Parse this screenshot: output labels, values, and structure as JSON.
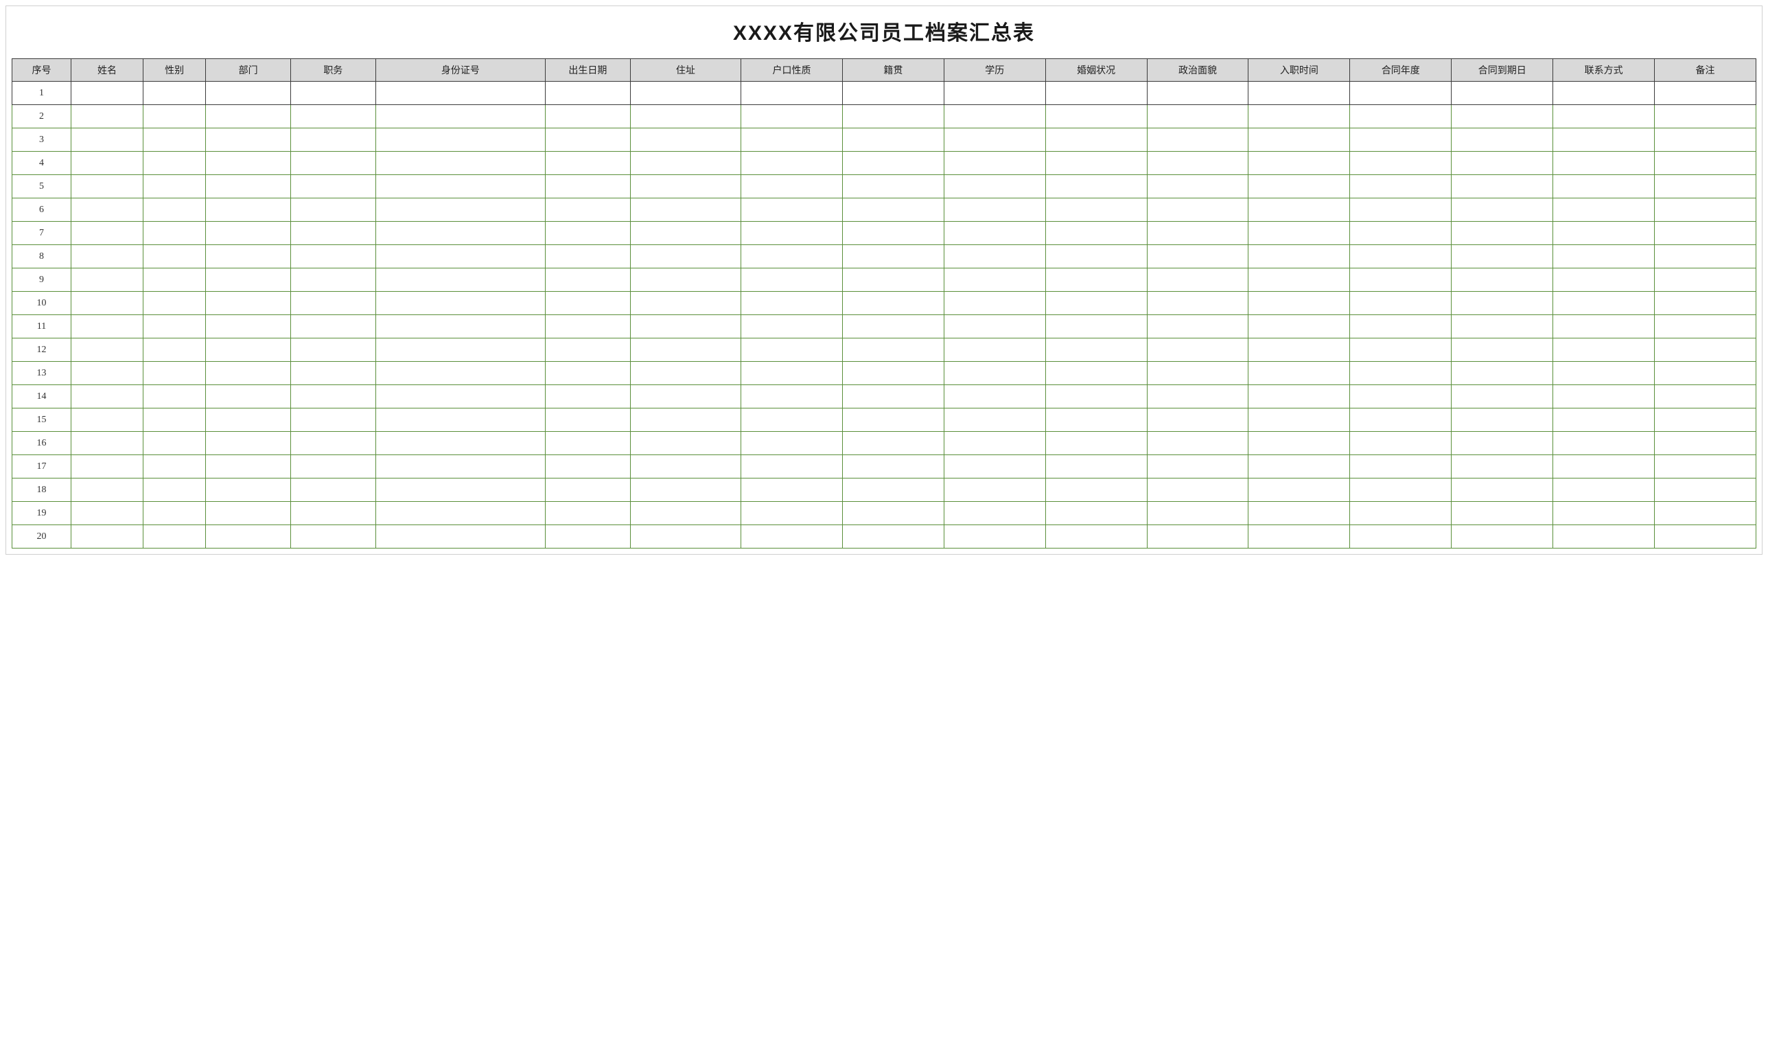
{
  "title": "XXXX有限公司员工档案汇总表",
  "headers": [
    "序号",
    "姓名",
    "性别",
    "部门",
    "职务",
    "身份证号",
    "出生日期",
    "住址",
    "户口性质",
    "籍贯",
    "学历",
    "婚姻状况",
    "政治面貌",
    "入职时间",
    "合同年度",
    "合同到期日",
    "联系方式",
    "备注"
  ],
  "col_classes": [
    "col-seq",
    "col-name",
    "col-gender",
    "col-dept",
    "col-pos",
    "col-id",
    "col-birth",
    "col-addr",
    "col-huko",
    "col-origin",
    "col-edu",
    "col-marital",
    "col-polit",
    "col-hire",
    "col-cyear",
    "col-cexp",
    "col-contact",
    "col-remark"
  ],
  "rows": [
    {
      "seq": "1",
      "cells": [
        "",
        "",
        "",
        "",
        "",
        "",
        "",
        "",
        "",
        "",
        "",
        "",
        "",
        "",
        "",
        "",
        ""
      ]
    },
    {
      "seq": "2",
      "cells": [
        "",
        "",
        "",
        "",
        "",
        "",
        "",
        "",
        "",
        "",
        "",
        "",
        "",
        "",
        "",
        "",
        ""
      ]
    },
    {
      "seq": "3",
      "cells": [
        "",
        "",
        "",
        "",
        "",
        "",
        "",
        "",
        "",
        "",
        "",
        "",
        "",
        "",
        "",
        "",
        ""
      ]
    },
    {
      "seq": "4",
      "cells": [
        "",
        "",
        "",
        "",
        "",
        "",
        "",
        "",
        "",
        "",
        "",
        "",
        "",
        "",
        "",
        "",
        ""
      ]
    },
    {
      "seq": "5",
      "cells": [
        "",
        "",
        "",
        "",
        "",
        "",
        "",
        "",
        "",
        "",
        "",
        "",
        "",
        "",
        "",
        "",
        ""
      ]
    },
    {
      "seq": "6",
      "cells": [
        "",
        "",
        "",
        "",
        "",
        "",
        "",
        "",
        "",
        "",
        "",
        "",
        "",
        "",
        "",
        "",
        ""
      ]
    },
    {
      "seq": "7",
      "cells": [
        "",
        "",
        "",
        "",
        "",
        "",
        "",
        "",
        "",
        "",
        "",
        "",
        "",
        "",
        "",
        "",
        ""
      ]
    },
    {
      "seq": "8",
      "cells": [
        "",
        "",
        "",
        "",
        "",
        "",
        "",
        "",
        "",
        "",
        "",
        "",
        "",
        "",
        "",
        "",
        ""
      ]
    },
    {
      "seq": "9",
      "cells": [
        "",
        "",
        "",
        "",
        "",
        "",
        "",
        "",
        "",
        "",
        "",
        "",
        "",
        "",
        "",
        "",
        ""
      ]
    },
    {
      "seq": "10",
      "cells": [
        "",
        "",
        "",
        "",
        "",
        "",
        "",
        "",
        "",
        "",
        "",
        "",
        "",
        "",
        "",
        "",
        ""
      ]
    },
    {
      "seq": "11",
      "cells": [
        "",
        "",
        "",
        "",
        "",
        "",
        "",
        "",
        "",
        "",
        "",
        "",
        "",
        "",
        "",
        "",
        ""
      ]
    },
    {
      "seq": "12",
      "cells": [
        "",
        "",
        "",
        "",
        "",
        "",
        "",
        "",
        "",
        "",
        "",
        "",
        "",
        "",
        "",
        "",
        ""
      ]
    },
    {
      "seq": "13",
      "cells": [
        "",
        "",
        "",
        "",
        "",
        "",
        "",
        "",
        "",
        "",
        "",
        "",
        "",
        "",
        "",
        "",
        ""
      ]
    },
    {
      "seq": "14",
      "cells": [
        "",
        "",
        "",
        "",
        "",
        "",
        "",
        "",
        "",
        "",
        "",
        "",
        "",
        "",
        "",
        "",
        ""
      ]
    },
    {
      "seq": "15",
      "cells": [
        "",
        "",
        "",
        "",
        "",
        "",
        "",
        "",
        "",
        "",
        "",
        "",
        "",
        "",
        "",
        "",
        ""
      ]
    },
    {
      "seq": "16",
      "cells": [
        "",
        "",
        "",
        "",
        "",
        "",
        "",
        "",
        "",
        "",
        "",
        "",
        "",
        "",
        "",
        "",
        ""
      ]
    },
    {
      "seq": "17",
      "cells": [
        "",
        "",
        "",
        "",
        "",
        "",
        "",
        "",
        "",
        "",
        "",
        "",
        "",
        "",
        "",
        "",
        ""
      ]
    },
    {
      "seq": "18",
      "cells": [
        "",
        "",
        "",
        "",
        "",
        "",
        "",
        "",
        "",
        "",
        "",
        "",
        "",
        "",
        "",
        "",
        ""
      ]
    },
    {
      "seq": "19",
      "cells": [
        "",
        "",
        "",
        "",
        "",
        "",
        "",
        "",
        "",
        "",
        "",
        "",
        "",
        "",
        "",
        "",
        ""
      ]
    },
    {
      "seq": "20",
      "cells": [
        "",
        "",
        "",
        "",
        "",
        "",
        "",
        "",
        "",
        "",
        "",
        "",
        "",
        "",
        "",
        "",
        ""
      ]
    }
  ]
}
